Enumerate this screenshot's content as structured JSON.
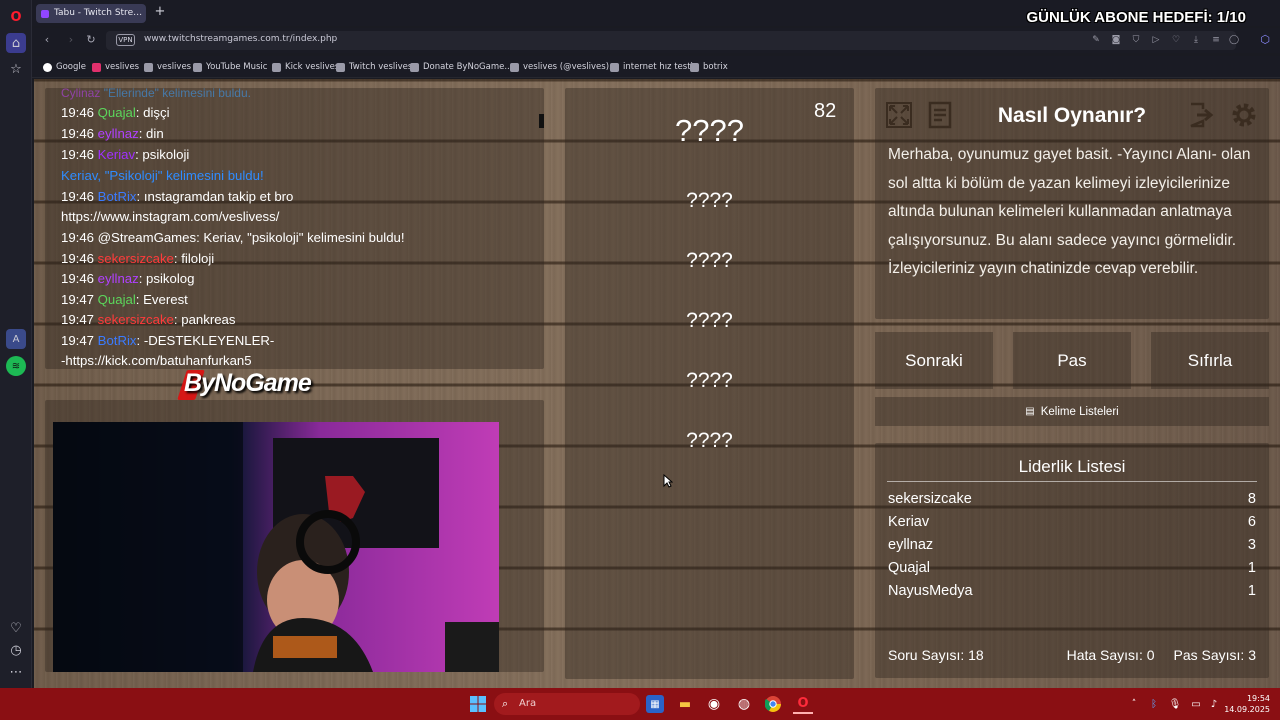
{
  "browser": {
    "tab_title": "Tabu - Twitch Stream Games",
    "url": "www.twitchstreamgames.com.tr/index.php",
    "vpn_label": "VPN",
    "bookmarks": [
      "Google",
      "veslives",
      "veslives",
      "YouTube Music",
      "Kick veslives",
      "Twitch veslives",
      "Donate ByNoGame...",
      "veslives (@veslives)...",
      "internet hız testi",
      "botrix"
    ]
  },
  "overlay": {
    "sub_goal": "GÜNLÜK ABONE HEDEFİ: 1/10"
  },
  "chat": [
    {
      "time": "",
      "user": "Cylinaz",
      "user_color": "#c040ff",
      "text": " \"Ellerinde\" kelimesini buldu.",
      "text_color": "#3aa0ff"
    },
    {
      "time": "19:46",
      "user": "Quajal",
      "user_color": "#5cd65c",
      "text": ": dişçi",
      "text_color": "#ffffff"
    },
    {
      "time": "19:46",
      "user": "eyllnaz",
      "user_color": "#b040ff",
      "text": ": din",
      "text_color": "#ffffff"
    },
    {
      "time": "19:46",
      "user": "Keriav",
      "user_color": "#a030ff",
      "text": ": psikoloji",
      "text_color": "#ffffff"
    },
    {
      "time": "",
      "user": "Keriav, \"Psikoloji\"",
      "user_color": "#2f8cff",
      "text": " kelimesini buldu!",
      "text_color": "#2f8cff"
    },
    {
      "time": "19:46",
      "user": "BotRix",
      "user_color": "#3b7bff",
      "text": ": ınstagramdan takip et bro",
      "text_color": "#ffffff"
    },
    {
      "time": "",
      "user": "",
      "user_color": "#ffffff",
      "text": "https://www.instagram.com/veslivess/",
      "text_color": "#ffffff"
    },
    {
      "time": "19:46",
      "user": "@StreamGames",
      "user_color": "#ffffff",
      "text": ": Keriav, \"psikoloji\" kelimesini buldu!",
      "text_color": "#ffffff"
    },
    {
      "time": "19:46",
      "user": "sekersizcake",
      "user_color": "#ff3b3b",
      "text": ": filoloji",
      "text_color": "#ffffff"
    },
    {
      "time": "19:46",
      "user": "eyllnaz",
      "user_color": "#b040ff",
      "text": ": psikolog",
      "text_color": "#ffffff"
    },
    {
      "time": "19:47",
      "user": "Quajal",
      "user_color": "#5cd65c",
      "text": ": Everest",
      "text_color": "#ffffff"
    },
    {
      "time": "19:47",
      "user": "sekersizcake",
      "user_color": "#ff3b3b",
      "text": ": pankreas",
      "text_color": "#ffffff"
    },
    {
      "time": "19:47",
      "user": "BotRix",
      "user_color": "#3b7bff",
      "text": ": -DESTEKLEYENLER-",
      "text_color": "#ffffff"
    },
    {
      "time": "",
      "user": "",
      "user_color": "#ffffff",
      "text": "-https://kick.com/batuhanfurkan5",
      "text_color": "#ffffff"
    }
  ],
  "sponsor": "ByNoGame",
  "game": {
    "timer": "82",
    "main_word": "????",
    "taboo_words": [
      "????",
      "????",
      "????",
      "????",
      "????"
    ]
  },
  "rules": {
    "title": "Nasıl Oynanır?",
    "text": "Merhaba, oyunumuz gayet basit. -Yayıncı Alanı- olan sol altta ki bölüm de yazan kelimeyi izleyicilerinize altında bulunan kelimeleri kullanmadan anlatmaya çalışıyorsunuz. Bu alanı sadece yayıncı görmelidir. İzleyicileriniz yayın chatinizde cevap verebilir."
  },
  "buttons": {
    "next": "Sonraki",
    "pass": "Pas",
    "reset": "Sıfırla",
    "word_lists": "Kelime Listeleri"
  },
  "leaderboard": {
    "title": "Liderlik Listesi",
    "rows": [
      {
        "name": "sekersizcake",
        "score": "8"
      },
      {
        "name": "Keriav",
        "score": "6"
      },
      {
        "name": "eyllnaz",
        "score": "3"
      },
      {
        "name": "Quajal",
        "score": "1"
      },
      {
        "name": "NayusMedya",
        "score": "1"
      }
    ]
  },
  "stats": {
    "questions": "Soru Sayısı: 18",
    "errors": "Hata Sayısı: 0",
    "passes": "Pas Sayısı: 3"
  },
  "taskbar": {
    "search_placeholder": "Ara",
    "time": "19:54",
    "date": "14.09.2025"
  },
  "colors": {
    "wood": "#7b6754",
    "panel": "rgba(48,38,30,0.42)",
    "taskbar": "#8a0f13"
  }
}
